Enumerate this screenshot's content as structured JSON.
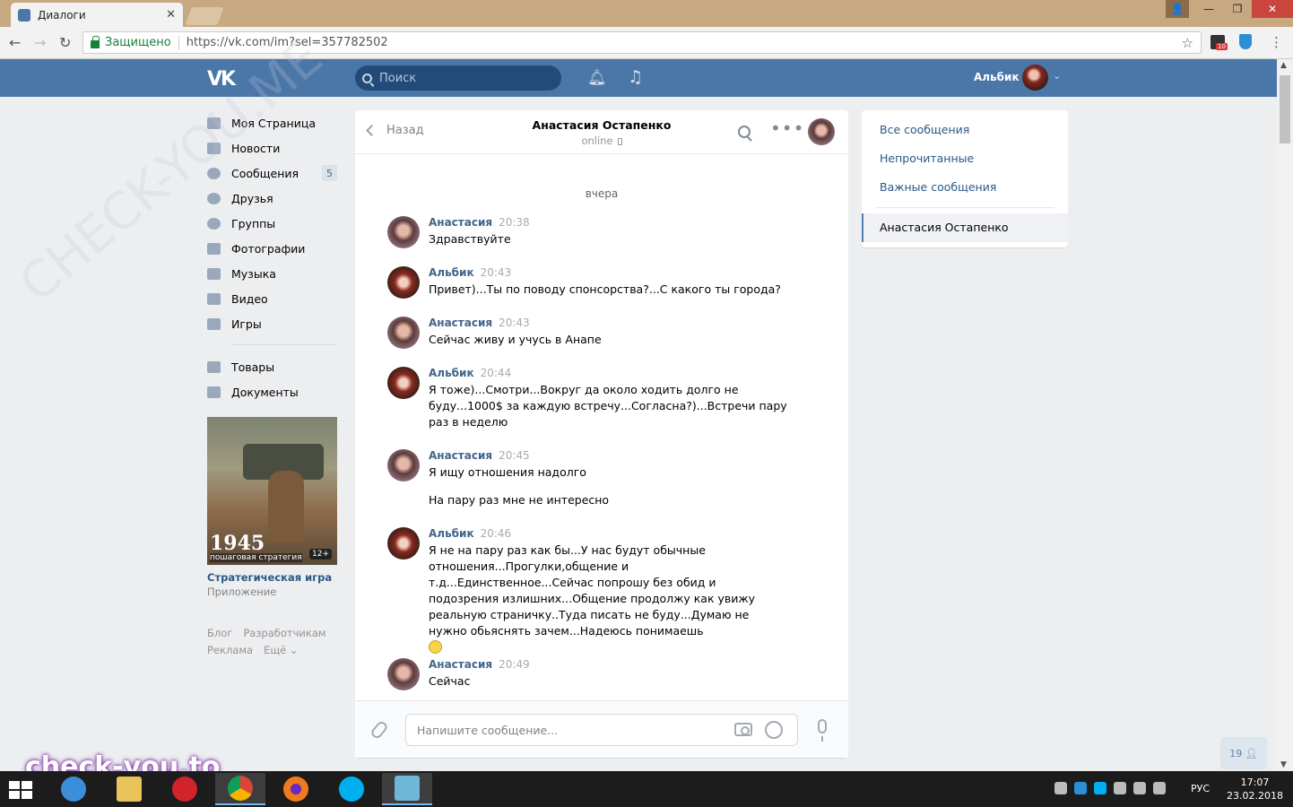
{
  "browser": {
    "tab_title": "Диалоги",
    "secure_label": "Защищено",
    "url": "https://vk.com/im?sel=357782502",
    "ext_badge": "10"
  },
  "header": {
    "logo": "VK",
    "search_placeholder": "Поиск",
    "user_name": "Альбик"
  },
  "left_menu": {
    "items": [
      {
        "label": "Моя Страница"
      },
      {
        "label": "Новости"
      },
      {
        "label": "Сообщения",
        "badge": "5"
      },
      {
        "label": "Друзья"
      },
      {
        "label": "Группы"
      },
      {
        "label": "Фотографии"
      },
      {
        "label": "Музыка"
      },
      {
        "label": "Видео"
      },
      {
        "label": "Игры"
      }
    ],
    "items2": [
      {
        "label": "Товары"
      },
      {
        "label": "Документы"
      }
    ],
    "ad": {
      "year": "1945",
      "subtitle": "пошаговая стратегия",
      "age": "12+",
      "title": "Стратегическая игра",
      "type": "Приложение"
    },
    "footer": [
      "Блог",
      "Разработчикам",
      "Реклама",
      "Ещё ⌄"
    ]
  },
  "chat": {
    "back_label": "Назад",
    "peer_name": "Анастасия Остапенко",
    "peer_status": "online",
    "day_label": "вчера",
    "messages": [
      {
        "author": "Анастасия",
        "time": "20:38",
        "text": "Здравствуйте"
      },
      {
        "author": "Альбик",
        "time": "20:43",
        "text": "Привет)...Ты по поводу спонсорства?...С какого ты города?"
      },
      {
        "author": "Анастасия",
        "time": "20:43",
        "text": "Сейчас живу и учусь в Анапе"
      },
      {
        "author": "Альбик",
        "time": "20:44",
        "text": "Я тоже)...Смотри...Вокруг да около ходить долго не буду...1000$ за каждую встречу...Согласна?)...Встречи пару раз в неделю"
      },
      {
        "author": "Анастасия",
        "time": "20:45",
        "text": "Я ищу отношения надолго",
        "text2": "На пару раз мне не интересно"
      },
      {
        "author": "Альбик",
        "time": "20:46",
        "text": "Я не на пару раз как бы...У нас будут обычные отношения...Прогулки,общение и т.д...Единственное...Сейчас попрошу без обид и подозрения излишних...Общение продолжу как увижу реальную страничку..Туда писать не буду...Думаю не нужно обьяснять зачем...Надеюсь понимаешь"
      },
      {
        "author": "Анастасия",
        "time": "20:49",
        "text": "Сейчас"
      }
    ],
    "input_placeholder": "Напишите сообщение..."
  },
  "right_menu": {
    "items": [
      "Все сообщения",
      "Непрочитанные",
      "Важные сообщения"
    ],
    "active": "Анастасия Остапенко"
  },
  "online_count": "19",
  "watermark": "CHECK-YOU.ME",
  "watermark2": "check-you.to",
  "taskbar": {
    "lang": "РУС",
    "time": "17:07",
    "date": "23.02.2018"
  }
}
